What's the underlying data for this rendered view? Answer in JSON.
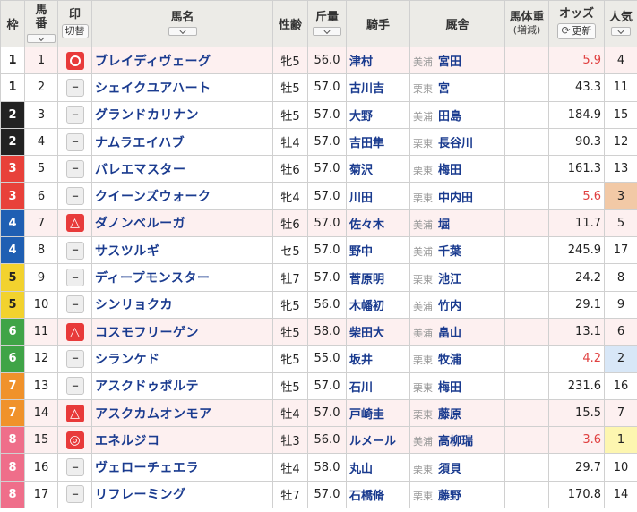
{
  "headers": {
    "waku": "枠",
    "umaban_line1": "馬",
    "umaban_line2": "番",
    "mark_line1": "印",
    "mark_toggle": "切替",
    "horse": "馬名",
    "sexage": "性齢",
    "weight": "斤量",
    "jockey": "騎手",
    "trainer": "厩舎",
    "bodyweight_line1": "馬体重",
    "bodyweight_line2": "(増減)",
    "odds": "オッズ",
    "odds_refresh": "更新",
    "popularity_line1": "人気"
  },
  "mark_empty_text": "--",
  "colors": {
    "waku": {
      "1": "#ffffff",
      "2": "#222222",
      "3": "#e8413a",
      "4": "#1f5fb3",
      "5": "#f2d22e",
      "6": "#3fa447",
      "7": "#f0922b",
      "8": "#ef6e8a"
    },
    "link_text": "#1a3b8f",
    "hot_odds": "#e04040",
    "mark_red": "#e83a3a"
  },
  "rows": [
    {
      "waku": "1",
      "umaban": "1",
      "mark": "circle",
      "horse": "ブレイディヴェーグ",
      "sexage": "牝5",
      "weight": "56.0",
      "jockey": "津村",
      "region": "美浦",
      "trainer": "宮田",
      "bodyweight": "",
      "odds": "5.9",
      "hot": true,
      "pop": "4"
    },
    {
      "waku": "1",
      "umaban": "2",
      "mark": "none",
      "horse": "シェイクユアハート",
      "sexage": "牡5",
      "weight": "57.0",
      "jockey": "古川吉",
      "region": "栗東",
      "trainer": "宮",
      "bodyweight": "",
      "odds": "43.3",
      "hot": false,
      "pop": "11"
    },
    {
      "waku": "2",
      "umaban": "3",
      "mark": "none",
      "horse": "グランドカリナン",
      "sexage": "牡5",
      "weight": "57.0",
      "jockey": "大野",
      "region": "美浦",
      "trainer": "田島",
      "bodyweight": "",
      "odds": "184.9",
      "hot": false,
      "pop": "15"
    },
    {
      "waku": "2",
      "umaban": "4",
      "mark": "none",
      "horse": "ナムラエイハブ",
      "sexage": "牡4",
      "weight": "57.0",
      "jockey": "吉田隼",
      "region": "栗東",
      "trainer": "長谷川",
      "bodyweight": "",
      "odds": "90.3",
      "hot": false,
      "pop": "12"
    },
    {
      "waku": "3",
      "umaban": "5",
      "mark": "none",
      "horse": "バレエマスター",
      "sexage": "牡6",
      "weight": "57.0",
      "jockey": "菊沢",
      "region": "栗東",
      "trainer": "梅田",
      "bodyweight": "",
      "odds": "161.3",
      "hot": false,
      "pop": "13"
    },
    {
      "waku": "3",
      "umaban": "6",
      "mark": "none",
      "horse": "クイーンズウォーク",
      "sexage": "牝4",
      "weight": "57.0",
      "jockey": "川田",
      "region": "栗東",
      "trainer": "中内田",
      "bodyweight": "",
      "odds": "5.6",
      "hot": true,
      "pop": "3"
    },
    {
      "waku": "4",
      "umaban": "7",
      "mark": "triangle",
      "horse": "ダノンベルーガ",
      "sexage": "牡6",
      "weight": "57.0",
      "jockey": "佐々木",
      "region": "美浦",
      "trainer": "堀",
      "bodyweight": "",
      "odds": "11.7",
      "hot": false,
      "pop": "5"
    },
    {
      "waku": "4",
      "umaban": "8",
      "mark": "none",
      "horse": "サスツルギ",
      "sexage": "セ5",
      "weight": "57.0",
      "jockey": "野中",
      "region": "美浦",
      "trainer": "千葉",
      "bodyweight": "",
      "odds": "245.9",
      "hot": false,
      "pop": "17"
    },
    {
      "waku": "5",
      "umaban": "9",
      "mark": "none",
      "horse": "ディープモンスター",
      "sexage": "牡7",
      "weight": "57.0",
      "jockey": "菅原明",
      "region": "栗東",
      "trainer": "池江",
      "bodyweight": "",
      "odds": "24.2",
      "hot": false,
      "pop": "8"
    },
    {
      "waku": "5",
      "umaban": "10",
      "mark": "none",
      "horse": "シンリョクカ",
      "sexage": "牝5",
      "weight": "56.0",
      "jockey": "木幡初",
      "region": "美浦",
      "trainer": "竹内",
      "bodyweight": "",
      "odds": "29.1",
      "hot": false,
      "pop": "9"
    },
    {
      "waku": "6",
      "umaban": "11",
      "mark": "triangle",
      "horse": "コスモフリーゲン",
      "sexage": "牡5",
      "weight": "58.0",
      "jockey": "柴田大",
      "region": "美浦",
      "trainer": "畠山",
      "bodyweight": "",
      "odds": "13.1",
      "hot": false,
      "pop": "6"
    },
    {
      "waku": "6",
      "umaban": "12",
      "mark": "none",
      "horse": "シランケド",
      "sexage": "牝5",
      "weight": "55.0",
      "jockey": "坂井",
      "region": "栗東",
      "trainer": "牧浦",
      "bodyweight": "",
      "odds": "4.2",
      "hot": true,
      "pop": "2"
    },
    {
      "waku": "7",
      "umaban": "13",
      "mark": "none",
      "horse": "アスクドゥポルテ",
      "sexage": "牡5",
      "weight": "57.0",
      "jockey": "石川",
      "region": "栗東",
      "trainer": "梅田",
      "bodyweight": "",
      "odds": "231.6",
      "hot": false,
      "pop": "16"
    },
    {
      "waku": "7",
      "umaban": "14",
      "mark": "triangle",
      "horse": "アスクカムオンモア",
      "sexage": "牡4",
      "weight": "57.0",
      "jockey": "戸崎圭",
      "region": "栗東",
      "trainer": "藤原",
      "bodyweight": "",
      "odds": "15.5",
      "hot": false,
      "pop": "7"
    },
    {
      "waku": "8",
      "umaban": "15",
      "mark": "double",
      "horse": "エネルジコ",
      "sexage": "牡3",
      "weight": "56.0",
      "jockey": "ルメール",
      "region": "美浦",
      "trainer": "高柳瑞",
      "bodyweight": "",
      "odds": "3.6",
      "hot": true,
      "pop": "1"
    },
    {
      "waku": "8",
      "umaban": "16",
      "mark": "none",
      "horse": "ヴェローチェエラ",
      "sexage": "牡4",
      "weight": "58.0",
      "jockey": "丸山",
      "region": "栗東",
      "trainer": "須貝",
      "bodyweight": "",
      "odds": "29.7",
      "hot": false,
      "pop": "10"
    },
    {
      "waku": "8",
      "umaban": "17",
      "mark": "none",
      "horse": "リフレーミング",
      "sexage": "牡7",
      "weight": "57.0",
      "jockey": "石橋脩",
      "region": "栗東",
      "trainer": "藤野",
      "bodyweight": "",
      "odds": "170.8",
      "hot": false,
      "pop": "14"
    }
  ]
}
